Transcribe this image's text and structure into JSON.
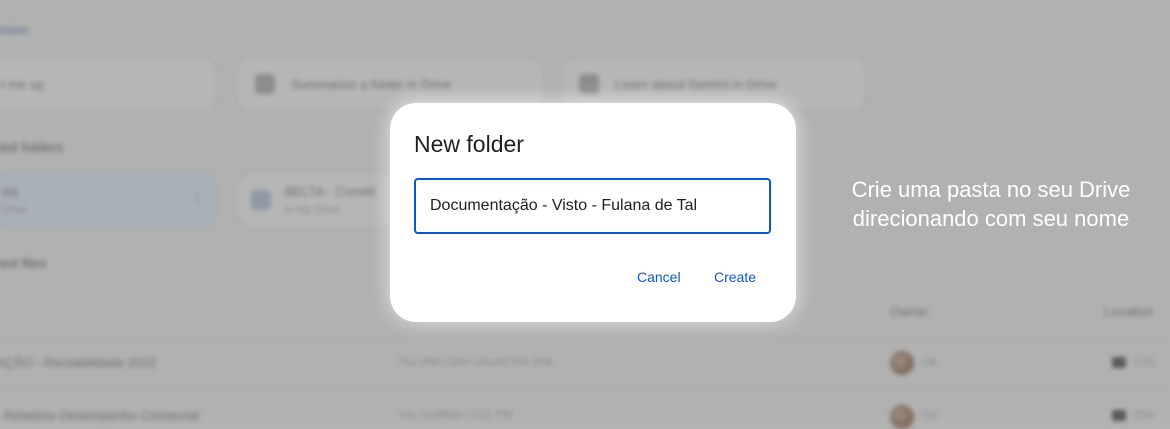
{
  "background": {
    "link_fragment": "ssion",
    "suggestion_cards": [
      {
        "label": "t me up"
      },
      {
        "label": "Summarize a folder in Drive"
      },
      {
        "label": "Learn about Gemini in Drive"
      }
    ],
    "folders_heading": "ted folders",
    "folders": [
      {
        "name": "sta",
        "sub": "Drive"
      },
      {
        "name": "BELTA - Comitê",
        "sub": "in My Drive"
      }
    ],
    "files_heading": "ted files",
    "columns": {
      "owner": "Owner",
      "location": "Location"
    },
    "files": [
      {
        "name": "AÇÃO - Rentabilidade 2022",
        "reason": "You often open around this time",
        "owner": "me",
        "location": "COL"
      },
      {
        "name": "- Relatório Desempenho Comercial",
        "reason": "You modified • 3:01 PM",
        "owner": "me",
        "location": "Dire"
      }
    ]
  },
  "dialog": {
    "title": "New folder",
    "input_value": "Documentação - Visto - Fulana de Tal",
    "cancel_label": "Cancel",
    "create_label": "Create",
    "accent": "#0b57d0"
  },
  "caption": {
    "line1": "Crie uma pasta no seu Drive",
    "line2": "direcionando com seu nome"
  }
}
